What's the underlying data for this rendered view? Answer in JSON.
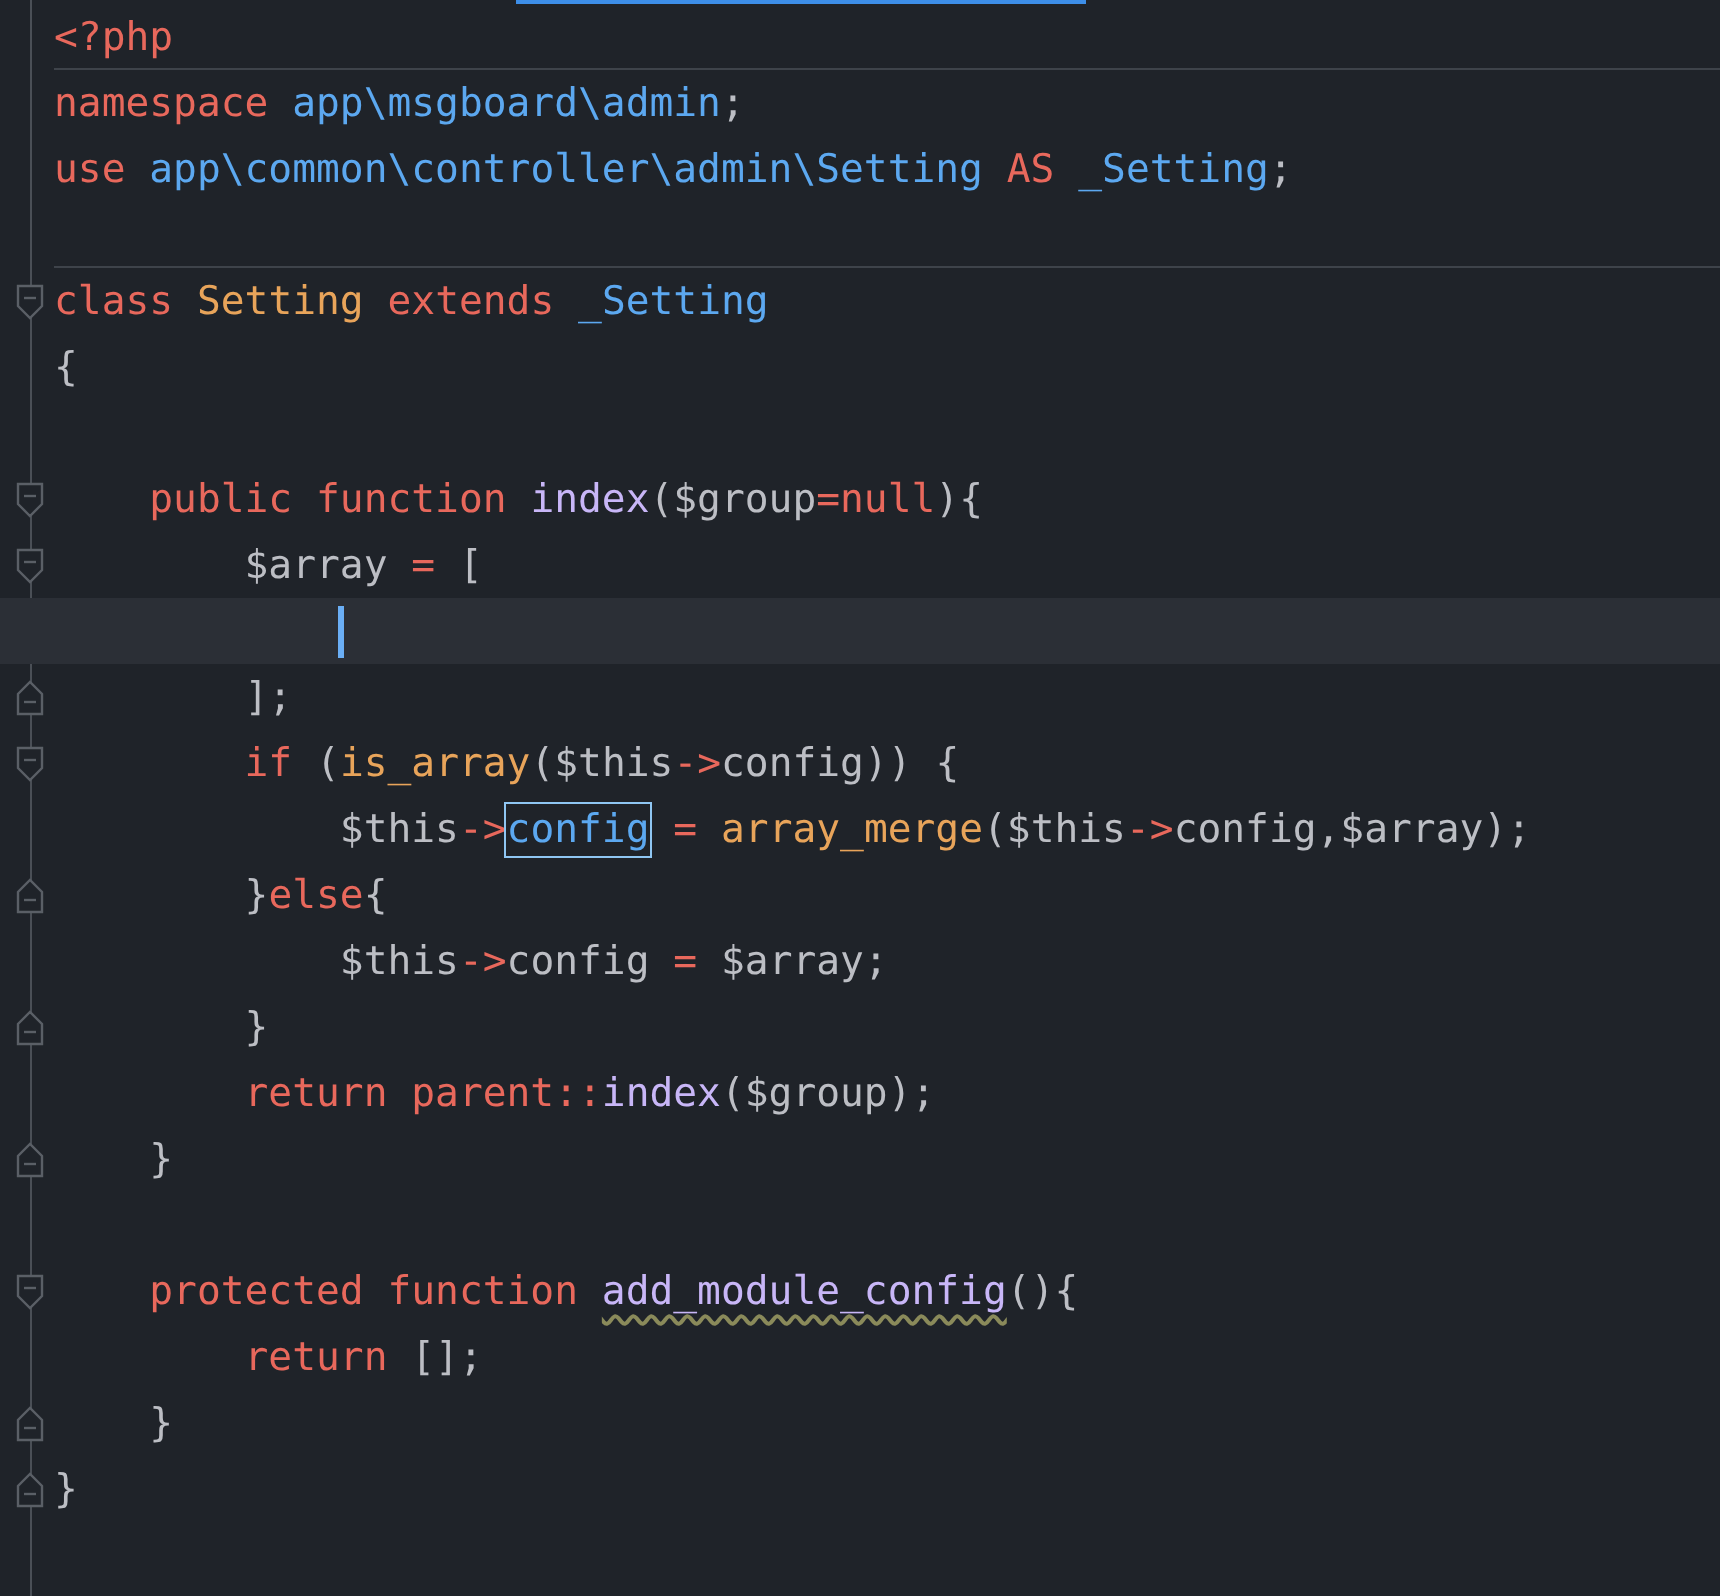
{
  "lines": [
    {
      "fold_start": false,
      "fold_end": false,
      "separator_below": true,
      "tokens": [
        {
          "kind": "keyword",
          "text": "<?php"
        }
      ]
    },
    {
      "fold_start": false,
      "fold_end": false,
      "separator_below": false,
      "tokens": [
        {
          "kind": "keyword",
          "text": "namespace "
        },
        {
          "kind": "namespace",
          "text": "app\\msgboard\\admin"
        },
        {
          "kind": "plain",
          "text": ";"
        }
      ]
    },
    {
      "fold_start": false,
      "fold_end": false,
      "separator_below": false,
      "tokens": [
        {
          "kind": "keyword",
          "text": "use "
        },
        {
          "kind": "namespace",
          "text": "app\\common\\controller\\admin\\Setting "
        },
        {
          "kind": "keyword",
          "text": "AS "
        },
        {
          "kind": "namespace",
          "text": "_Setting"
        },
        {
          "kind": "plain",
          "text": ";"
        }
      ]
    },
    {
      "fold_start": false,
      "fold_end": false,
      "separator_below": true
    },
    {
      "fold_start": true,
      "fold_end": false,
      "separator_below": false,
      "tokens": [
        {
          "kind": "keyword",
          "text": "class "
        },
        {
          "kind": "class",
          "text": "Setting "
        },
        {
          "kind": "keyword",
          "text": "extends "
        },
        {
          "kind": "namespace",
          "text": "_Setting"
        }
      ]
    },
    {
      "fold_start": false,
      "fold_end": false,
      "separator_below": false,
      "tokens": [
        {
          "kind": "plain",
          "text": "{"
        }
      ]
    },
    {
      "fold_start": false,
      "fold_end": false,
      "separator_below": false
    },
    {
      "fold_start": true,
      "fold_end": false,
      "separator_below": false,
      "tokens": [
        {
          "kind": "keyword",
          "text": "    public function "
        },
        {
          "kind": "function",
          "text": "index"
        },
        {
          "kind": "plain",
          "text": "($group"
        },
        {
          "kind": "keyword",
          "text": "=null"
        },
        {
          "kind": "plain",
          "text": "){"
        }
      ]
    },
    {
      "fold_start": true,
      "fold_end": false,
      "separator_below": false,
      "tokens": [
        {
          "kind": "plain",
          "text": "        $array "
        },
        {
          "kind": "keyword",
          "text": "= "
        },
        {
          "kind": "plain",
          "text": "["
        }
      ]
    },
    {
      "fold_start": false,
      "fold_end": false,
      "separator_below": false,
      "current": true,
      "caret": true
    },
    {
      "fold_start": false,
      "fold_end": true,
      "separator_below": false,
      "tokens": [
        {
          "kind": "plain",
          "text": "        ];"
        }
      ]
    },
    {
      "fold_start": true,
      "fold_end": false,
      "separator_below": false,
      "tokens": [
        {
          "kind": "keyword",
          "text": "        if "
        },
        {
          "kind": "plain",
          "text": "("
        },
        {
          "kind": "builtin",
          "text": "is_array"
        },
        {
          "kind": "plain",
          "text": "($this"
        },
        {
          "kind": "keyword",
          "text": "->"
        },
        {
          "kind": "plain",
          "text": "config)) {"
        }
      ]
    },
    {
      "fold_start": false,
      "fold_end": false,
      "separator_below": false,
      "tokens": [
        {
          "kind": "plain",
          "text": "            $this"
        },
        {
          "kind": "keyword",
          "text": "->"
        },
        {
          "kind": "property",
          "text": "config",
          "boxed": true
        },
        {
          "kind": "keyword",
          "text": " = "
        },
        {
          "kind": "builtin",
          "text": "array_merge"
        },
        {
          "kind": "plain",
          "text": "($this"
        },
        {
          "kind": "keyword",
          "text": "->"
        },
        {
          "kind": "plain",
          "text": "config,$array);"
        }
      ]
    },
    {
      "fold_start": false,
      "fold_end": true,
      "separator_below": false,
      "tokens": [
        {
          "kind": "plain",
          "text": "        }"
        },
        {
          "kind": "keyword",
          "text": "else"
        },
        {
          "kind": "plain",
          "text": "{"
        }
      ]
    },
    {
      "fold_start": false,
      "fold_end": false,
      "separator_below": false,
      "tokens": [
        {
          "kind": "plain",
          "text": "            $this"
        },
        {
          "kind": "keyword",
          "text": "->"
        },
        {
          "kind": "plain",
          "text": "config "
        },
        {
          "kind": "keyword",
          "text": "= "
        },
        {
          "kind": "plain",
          "text": "$array;"
        }
      ]
    },
    {
      "fold_start": false,
      "fold_end": true,
      "separator_below": false,
      "tokens": [
        {
          "kind": "plain",
          "text": "        }"
        }
      ]
    },
    {
      "fold_start": false,
      "fold_end": false,
      "separator_below": false,
      "tokens": [
        {
          "kind": "keyword",
          "text": "        return parent::"
        },
        {
          "kind": "function",
          "text": "index"
        },
        {
          "kind": "plain",
          "text": "($group);"
        }
      ]
    },
    {
      "fold_start": false,
      "fold_end": true,
      "separator_below": false,
      "tokens": [
        {
          "kind": "plain",
          "text": "    }"
        }
      ]
    },
    {
      "fold_start": false,
      "fold_end": false,
      "separator_below": false
    },
    {
      "fold_start": true,
      "fold_end": false,
      "separator_below": false,
      "tokens": [
        {
          "kind": "keyword",
          "text": "    protected function "
        },
        {
          "kind": "function",
          "text": "add_module_config",
          "warning": true
        },
        {
          "kind": "plain",
          "text": "(){"
        }
      ]
    },
    {
      "fold_start": false,
      "fold_end": false,
      "separator_below": false,
      "tokens": [
        {
          "kind": "keyword",
          "text": "        return "
        },
        {
          "kind": "plain",
          "text": "[];"
        }
      ]
    },
    {
      "fold_start": false,
      "fold_end": true,
      "separator_below": false,
      "tokens": [
        {
          "kind": "plain",
          "text": "    }"
        }
      ]
    },
    {
      "fold_start": false,
      "fold_end": true,
      "separator_below": false,
      "tokens": [
        {
          "kind": "plain",
          "text": "}"
        }
      ]
    }
  ]
}
